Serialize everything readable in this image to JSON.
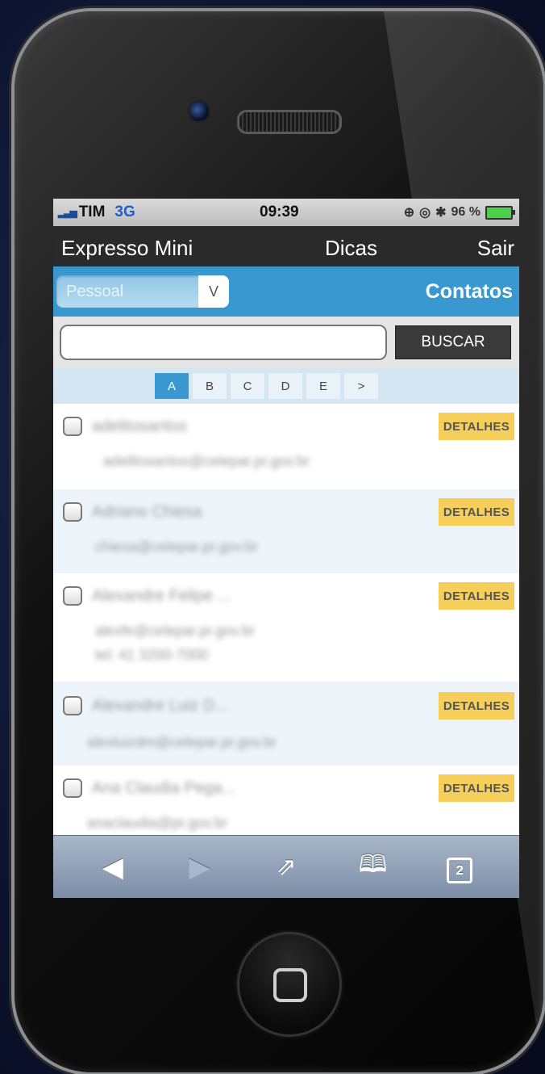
{
  "status": {
    "carrier": "TIM",
    "network": "3G",
    "time": "09:39",
    "battery": "96 %"
  },
  "nav": {
    "app_title": "Expresso Mini",
    "tips_link": "Dicas",
    "logout_link": "Sair"
  },
  "category": {
    "selected": "Pessoal",
    "title": "Contatos"
  },
  "search": {
    "value": "",
    "button_label": "BUSCAR"
  },
  "pager": {
    "letters": [
      "A",
      "B",
      "C",
      "D",
      "E",
      ">"
    ],
    "active": "A"
  },
  "contacts": [
    {
      "name": "adelitosantos",
      "details": [
        "adelitosantos@celepar.pr.gov.br"
      ],
      "button": "DETALHES"
    },
    {
      "name": "Adriano Chiesa",
      "details": [
        "chiesa@celepar.pr.gov.br"
      ],
      "button": "DETALHES"
    },
    {
      "name": "Alexandre Felipe ...",
      "details": [
        "alexfe@celepar.pr.gov.br",
        "tel: 41 3200-7000"
      ],
      "button": "DETALHES"
    },
    {
      "name": "Alexandre Luiz D...",
      "details": [
        "alexluizdm@celepar.pr.gov.br"
      ],
      "button": "DETALHES"
    },
    {
      "name": "Ana Claudia Pega...",
      "details": [
        "anaclaudia@pr.gov.br"
      ],
      "button": "DETALHES"
    }
  ],
  "toolbar": {
    "tabs_count": "2"
  },
  "colors": {
    "accent": "#3a98d0",
    "detail_button": "#f6cf5b",
    "nav_background": "#2a2a2a"
  }
}
